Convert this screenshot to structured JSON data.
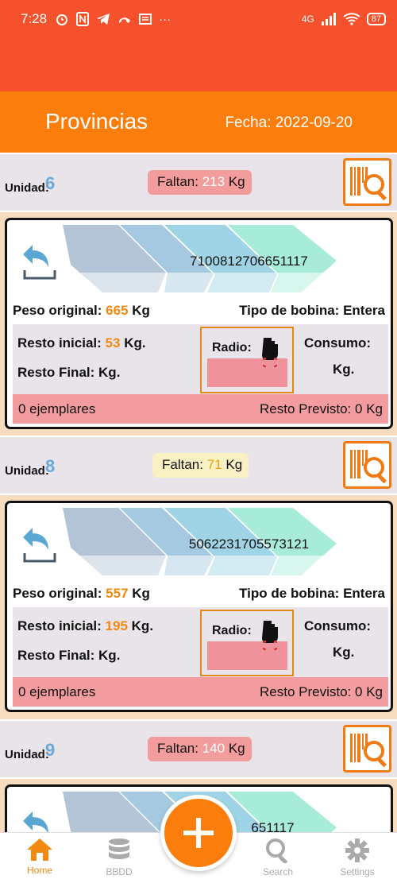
{
  "status": {
    "time": "7:28",
    "network": "4G",
    "battery": "87"
  },
  "header": {
    "title": "Provincias",
    "date": "Fecha: 2022-09-20"
  },
  "labels": {
    "unidad": "Unidad:",
    "faltan": "Faltan:",
    "kg": "Kg",
    "peso_original": "Peso original:",
    "tipo_bobina": "Tipo de bobina:",
    "resto_inicial": "Resto inicial:",
    "resto_final": "Resto Final:",
    "kg_dot": "Kg.",
    "radio": "Radio:",
    "consumo": "Consumo:",
    "resto_previsto": "Resto Previsto:"
  },
  "units": [
    {
      "unidad": "6",
      "faltan": "213",
      "faltan_color": "#f29c9c",
      "card": {
        "code": "7100812706651117",
        "peso_original": "665",
        "tipo": "Entera",
        "resto_inicial": "53",
        "ejemplares": "0 ejemplares",
        "resto_previsto": "0 Kg"
      }
    },
    {
      "unidad": "8",
      "faltan": "71",
      "faltan_color": "#f9f0c4",
      "card": {
        "code": "5062231705573121",
        "peso_original": "557",
        "tipo": "Entera",
        "resto_inicial": "195",
        "ejemplares": "0 ejemplares",
        "resto_previsto": "0 Kg"
      }
    },
    {
      "unidad": "9",
      "faltan": "140",
      "faltan_color": "#f29c9c",
      "card": {
        "code_partial": "651117"
      }
    }
  ],
  "nav": {
    "home": "Home",
    "bbdd": "BBDD",
    "search": "Search",
    "settings": "Settings"
  },
  "colors": {
    "status_red": "#f4512c",
    "header_orange": "#fb7d0c",
    "accent_orange": "#f28a12",
    "unit_blue": "#6aa8d8"
  }
}
